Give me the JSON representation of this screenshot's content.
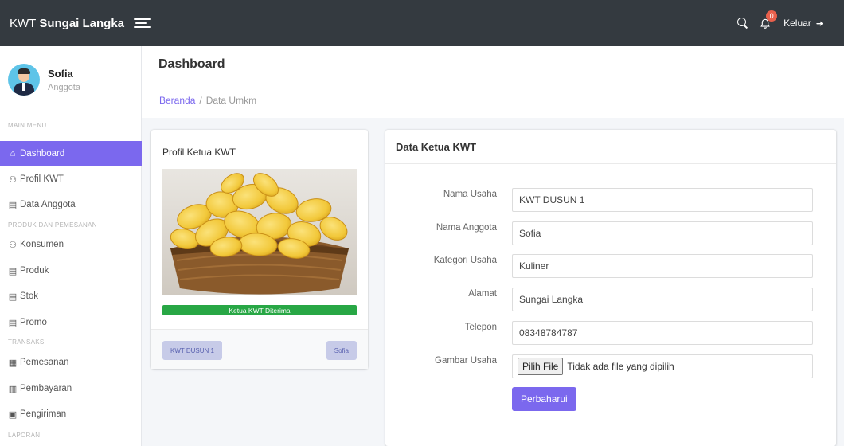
{
  "topbar": {
    "brand_light": "KWT",
    "brand_bold": "Sungai Langka",
    "notification_count": "0",
    "logout_label": "Keluar",
    "logout_icon": "sign-out-icon"
  },
  "sidebar": {
    "user": {
      "name": "Sofia",
      "role": "Anggota"
    },
    "sections": {
      "main": "MAIN MENU",
      "produk": "PRODUK DAN PEMESANAN",
      "transaksi": "TRANSAKSI",
      "laporan": "LAPORAN"
    },
    "items": [
      {
        "label": "Dashboard",
        "icon": "home-icon",
        "glyph": "⌂",
        "active": true
      },
      {
        "label": "Profil KWT",
        "icon": "users-icon",
        "glyph": "⚇"
      },
      {
        "label": "Data Anggota",
        "icon": "list-icon",
        "glyph": "▤"
      },
      {
        "label": "Konsumen",
        "icon": "users-icon",
        "glyph": "⚇"
      },
      {
        "label": "Produk",
        "icon": "list-icon",
        "glyph": "▤"
      },
      {
        "label": "Stok",
        "icon": "list-icon",
        "glyph": "▤"
      },
      {
        "label": "Promo",
        "icon": "list-icon",
        "glyph": "▤"
      },
      {
        "label": "Pemesanan",
        "icon": "table-icon",
        "glyph": "▦"
      },
      {
        "label": "Pembayaran",
        "icon": "receipt-icon",
        "glyph": "▥"
      },
      {
        "label": "Pengiriman",
        "icon": "box-icon",
        "glyph": "▣"
      }
    ]
  },
  "header": {
    "title": "Dashboard"
  },
  "breadcrumb": {
    "home": "Beranda",
    "current": "Data Umkm"
  },
  "profile_card": {
    "title": "Profil Ketua KWT",
    "progress_label": "Ketua KWT Diterima",
    "progress_fraction": 1.0,
    "tag_left": "KWT DUSUN 1",
    "tag_right": "Sofia"
  },
  "form_card": {
    "title": "Data Ketua KWT",
    "fields": [
      {
        "label": "Nama Usaha",
        "value": "KWT DUSUN 1"
      },
      {
        "label": "Nama Anggota",
        "value": "Sofia"
      },
      {
        "label": "Kategori Usaha",
        "value": "Kuliner"
      },
      {
        "label": "Alamat",
        "value": "Sungai Langka"
      },
      {
        "label": "Telepon",
        "value": "08348784787"
      }
    ],
    "file_field": {
      "label": "Gambar Usaha",
      "button": "Pilih File",
      "status": "Tidak ada file yang dipilih"
    },
    "submit_label": "Perbaharui"
  },
  "colors": {
    "accent": "#7b68ee",
    "topbar": "#343a40",
    "success": "#28a745",
    "badge": "#e8604c"
  }
}
